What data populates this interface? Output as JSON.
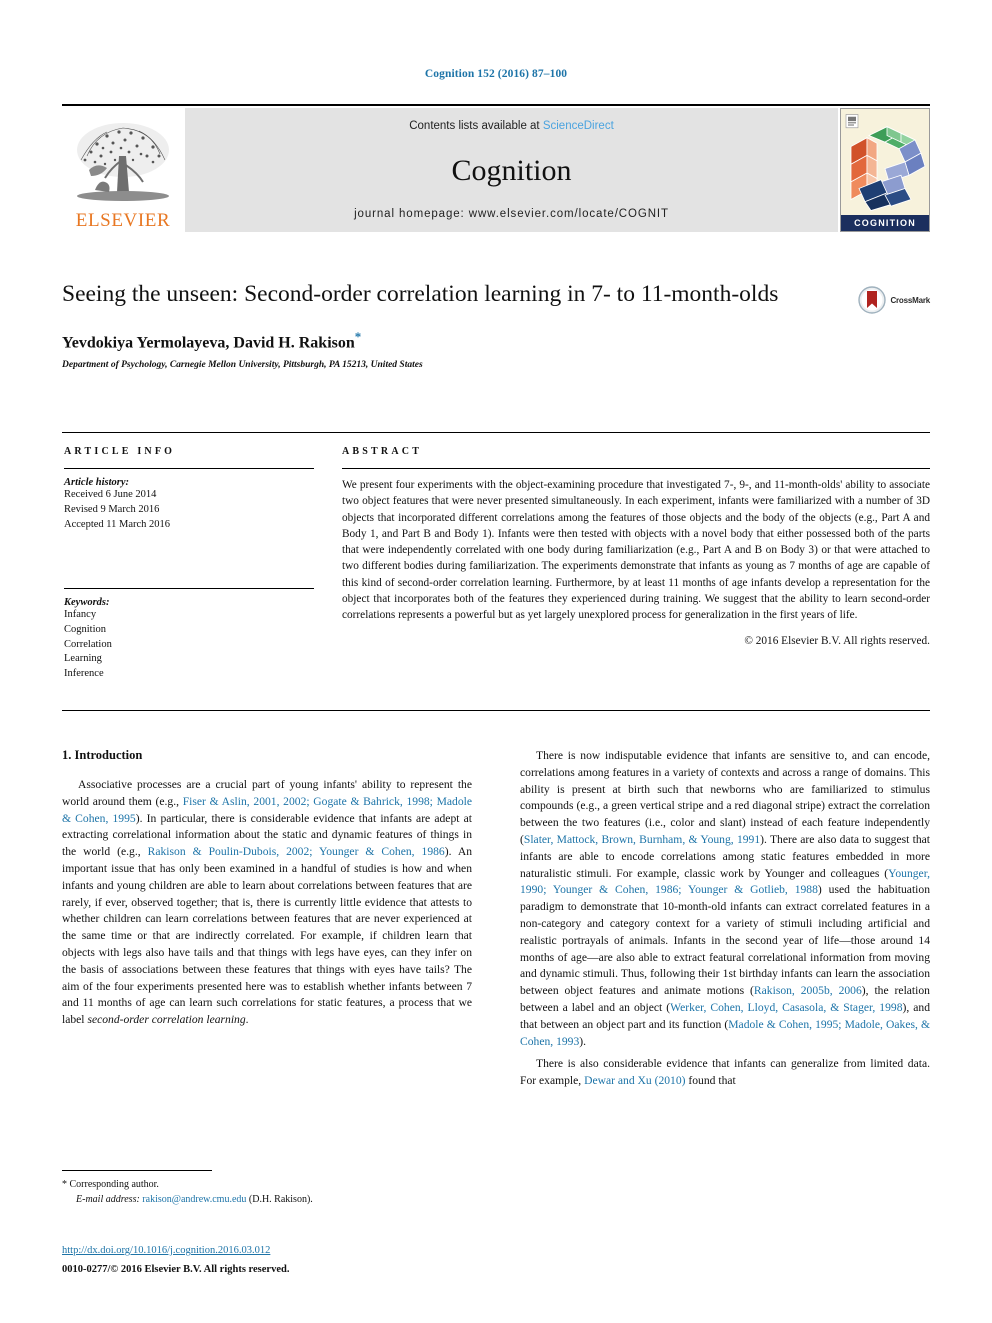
{
  "running_head": "Cognition 152 (2016) 87–100",
  "masthead": {
    "contents_prefix": "Contents lists available at ",
    "sciencedirect": "ScienceDirect",
    "journal_name": "Cognition",
    "homepage": "journal homepage: www.elsevier.com/locate/COGNIT",
    "publisher_wordmark": "ELSEVIER",
    "cover_label": "COGNITION"
  },
  "title": "Seeing the unseen: Second-order correlation learning in 7- to 11-month-olds",
  "crossmark_label": "CrossMark",
  "authors": "Yevdokiya Yermolayeva, David H. Rakison",
  "author_marker": "*",
  "affiliation": "Department of Psychology, Carnegie Mellon University, Pittsburgh, PA 15213, United States",
  "article_info": {
    "heading": "ARTICLE INFO",
    "history_label": "Article history:",
    "history": [
      "Received 6 June 2014",
      "Revised 9 March 2016",
      "Accepted 11 March 2016"
    ],
    "keywords_label": "Keywords:",
    "keywords": [
      "Infancy",
      "Cognition",
      "Correlation",
      "Learning",
      "Inference"
    ]
  },
  "abstract": {
    "heading": "ABSTRACT",
    "text": "We present four experiments with the object-examining procedure that investigated 7-, 9-, and 11-month-olds' ability to associate two object features that were never presented simultaneously. In each experiment, infants were familiarized with a number of 3D objects that incorporated different correlations among the features of those objects and the body of the objects (e.g., Part A and Body 1, and Part B and Body 1). Infants were then tested with objects with a novel body that either possessed both of the parts that were independently correlated with one body during familiarization (e.g., Part A and B on Body 3) or that were attached to two different bodies during familiarization. The experiments demonstrate that infants as young as 7 months of age are capable of this kind of second-order correlation learning. Furthermore, by at least 11 months of age infants develop a representation for the object that incorporates both of the features they experienced during training. We suggest that the ability to learn second-order correlations represents a powerful but as yet largely unexplored process for generalization in the first years of life.",
    "copyright": "© 2016 Elsevier B.V. All rights reserved."
  },
  "body": {
    "section_title": "1. Introduction",
    "left_paragraph_1": {
      "t1": "Associative processes are a crucial part of young infants' ability to represent the world around them (e.g., ",
      "c1": "Fiser & Aslin, 2001, 2002; Gogate & Bahrick, 1998; Madole & Cohen, 1995",
      "t2": "). In particular, there is considerable evidence that infants are adept at extracting correlational information about the static and dynamic features of things in the world (e.g., ",
      "c2": "Rakison & Poulin-Dubois, 2002; Younger & Cohen, 1986",
      "t3": "). An important issue that has only been examined in a handful of studies is how and when infants and young children are able to learn about correlations between features that are rarely, if ever, observed together; that is, there is currently little evidence that attests to whether children can learn correlations between features that are never experienced at the same time or that are indirectly correlated. For example, if children learn that objects with legs also have tails and that things with legs have eyes, can they infer on the basis of associations between these features that things with eyes have tails? The aim of the four experiments presented here was to establish whether infants between 7 and 11 months of age can learn such correlations for static features, a process that we label ",
      "i1": "second-order correlation learning",
      "t4": "."
    },
    "right_paragraph_1": {
      "t1": "There is now indisputable evidence that infants are sensitive to, and can encode, correlations among features in a variety of contexts and across a range of domains. This ability is present at birth such that newborns who are familiarized to stimulus compounds (e.g., a green vertical stripe and a red diagonal stripe) extract the correlation between the two features (i.e., color and slant) instead of each feature independently (",
      "c1": "Slater, Mattock, Brown, Burnham, & Young, 1991",
      "t2": "). There are also data to suggest that infants are able to encode correlations among static features embedded in more naturalistic stimuli. For example, classic work by Younger and colleagues (",
      "c2": "Younger, 1990; Younger & Cohen, 1986; Younger & Gotlieb, 1988",
      "t3": ") used the habituation paradigm to demonstrate that 10-month-old infants can extract correlated features in a non-category and category context for a variety of stimuli including artificial and realistic portrayals of animals. Infants in the second year of life—those around 14 months of age—are also able to extract featural correlational information from moving and dynamic stimuli. Thus, following their 1st birthday infants can learn the association between object features and animate motions (",
      "c3": "Rakison, 2005b, 2006",
      "t4": "), the relation between a label and an object (",
      "c4": "Werker, Cohen, Lloyd, Casasola, & Stager, 1998",
      "t5": "), and that between an object part and its function (",
      "c5": "Madole & Cohen, 1995; Madole, Oakes, & Cohen, 1993",
      "t6": ")."
    },
    "right_paragraph_2": {
      "t1": "There is also considerable evidence that infants can generalize from limited data. For example, ",
      "c1": "Dewar and Xu (2010)",
      "t2": " found that"
    }
  },
  "footnote": {
    "marker": "*",
    "corresponding": "Corresponding author.",
    "email_label": "E-mail address:",
    "email": "rakison@andrew.cmu.edu",
    "email_suffix": "(D.H. Rakison)."
  },
  "doi": "http://dx.doi.org/10.1016/j.cognition.2016.03.012",
  "issn_line": "0010-0277/© 2016 Elsevier B.V. All rights reserved.",
  "colors": {
    "link": "#1d74a8",
    "sciencedirect": "#4aa3df",
    "elsevier_orange": "#e87722",
    "band_gray": "#e3e3e3",
    "cover_navy": "#1b2f5e"
  }
}
